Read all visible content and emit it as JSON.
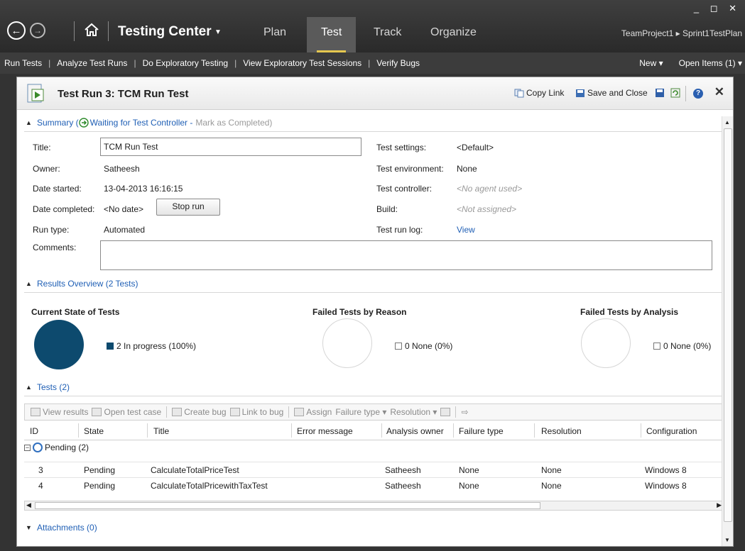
{
  "titlebar": {
    "app_title": "Testing Center",
    "tabs": [
      {
        "label": "Plan"
      },
      {
        "label": "Test"
      },
      {
        "label": "Track"
      },
      {
        "label": "Organize"
      }
    ],
    "project_path": "TeamProject1 ▸ Sprint1TestPlan",
    "window_controls": "_ ◻ ✕"
  },
  "menubar": {
    "items": [
      {
        "label": "Run Tests"
      },
      {
        "label": "Analyze Test Runs"
      },
      {
        "label": "Do Exploratory Testing"
      },
      {
        "label": "View Exploratory Test Sessions"
      },
      {
        "label": "Verify Bugs"
      }
    ],
    "new_label": "New ▾",
    "open_items_label": "Open Items (1) ▾"
  },
  "panel": {
    "title": "Test Run 3: TCM Run Test",
    "copy_link": "Copy Link",
    "save_close": "Save and Close"
  },
  "summary": {
    "section_label": "Summary (",
    "status_link": "Waiting for Test Controller -",
    "mark_completed": "Mark as Completed)",
    "title_label": "Title:",
    "title_value": "TCM Run Test",
    "owner_label": "Owner:",
    "owner_value": "Satheesh",
    "date_started_label": "Date started:",
    "date_started_value": "13-04-2013 16:16:15",
    "date_completed_label": "Date completed:",
    "date_completed_value": "<No date>",
    "stop_run": "Stop run",
    "run_type_label": "Run type:",
    "run_type_value": "Automated",
    "comments_label": "Comments:",
    "test_settings_label": "Test settings:",
    "test_settings_value": "<Default>",
    "test_env_label": "Test environment:",
    "test_env_value": "None",
    "test_controller_label": "Test controller:",
    "test_controller_value": "<No agent used>",
    "build_label": "Build:",
    "build_value": "<Not assigned>",
    "test_run_log_label": "Test run log:",
    "test_run_log_value": "View"
  },
  "results_overview": {
    "section_label": "Results Overview (2 Tests)",
    "charts": [
      {
        "title": "Current State of Tests",
        "legend": "2 In progress (100%)",
        "color": "#0d4a6e"
      },
      {
        "title": "Failed Tests by Reason",
        "legend": "0 None (0%)",
        "color": "#ffffff"
      },
      {
        "title": "Failed Tests by Analysis",
        "legend": "0 None (0%)",
        "color": "#ffffff"
      }
    ]
  },
  "tests": {
    "section_label": "Tests (2)",
    "toolbar": {
      "view_results": "View results",
      "open_test_case": "Open test case",
      "create_bug": "Create bug",
      "link_to_bug": "Link to bug",
      "assign": "Assign",
      "failure_type": "Failure type ▾",
      "resolution": "Resolution ▾"
    },
    "columns": [
      "ID",
      "State",
      "Title",
      "Error message",
      "Analysis owner",
      "Failure type",
      "Resolution",
      "Configuration"
    ],
    "group_label": "Pending (2)",
    "rows": [
      {
        "id": "3",
        "state": "Pending",
        "title": "CalculateTotalPriceTest",
        "error": "",
        "owner": "Satheesh",
        "failure": "None",
        "resolution": "None",
        "config": "Windows 8"
      },
      {
        "id": "4",
        "state": "Pending",
        "title": "CalculateTotalPricewithTaxTest",
        "error": "",
        "owner": "Satheesh",
        "failure": "None",
        "resolution": "None",
        "config": "Windows 8"
      }
    ]
  },
  "attachments": {
    "section_label": "Attachments (0)"
  }
}
